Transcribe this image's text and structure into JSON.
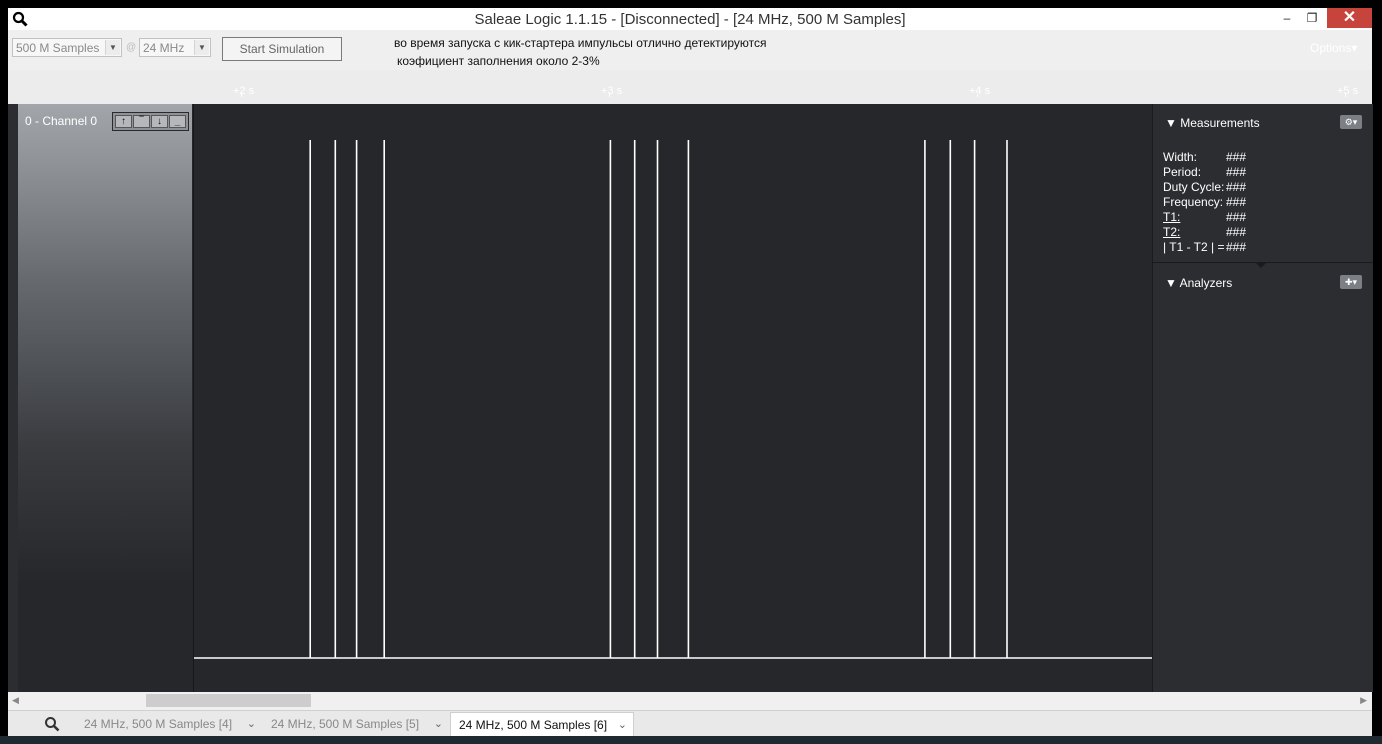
{
  "window": {
    "title": "Saleae Logic 1.1.15 - [Disconnected] - [24 MHz, 500 M Samples]",
    "min_glyph": "–",
    "max_glyph": "❐",
    "close_glyph": "✕"
  },
  "toolbar": {
    "samples_value": "500 M Samples",
    "at_symbol": "@",
    "rate_value": "24 MHz",
    "start_label": "Start Simulation",
    "note_line1": "во время запуска с кик-стартера импульсы отлично детектируются",
    "note_line2": "коэфициент заполнения около 2-3%",
    "options_label": "Options▾"
  },
  "ruler": {
    "ticks": [
      "+2 s",
      "+3 s",
      "+4 s",
      "+5 s"
    ]
  },
  "channel": {
    "label": "0 - Channel 0",
    "trigger_icons": [
      "rising-edge-icon",
      "high-level-icon",
      "falling-edge-icon",
      "low-level-icon"
    ]
  },
  "waveform": {
    "pulse_times_s": [
      2.174,
      2.242,
      2.3,
      2.375,
      2.99,
      3.056,
      3.118,
      3.202,
      3.845,
      3.914,
      3.98,
      4.068
    ],
    "view_start_s": 1.858,
    "view_end_s": 4.465
  },
  "measurements": {
    "header": "Measurements",
    "rows": [
      {
        "label": "Width:",
        "value": "###"
      },
      {
        "label": "Period:",
        "value": "###"
      },
      {
        "label": "Duty Cycle:",
        "value": "###"
      },
      {
        "label": "Frequency:",
        "value": "###"
      },
      {
        "label": "T1:",
        "value": "###"
      },
      {
        "label": "T2:",
        "value": "###"
      },
      {
        "label": "| T1 - T2 | =",
        "value": "###"
      }
    ]
  },
  "analyzers": {
    "header": "Analyzers"
  },
  "tabs": [
    {
      "label": "24 MHz, 500 M Samples [4]"
    },
    {
      "label": "24 MHz, 500 M Samples [5]"
    },
    {
      "label": "24 MHz, 500 M Samples [6]"
    }
  ]
}
